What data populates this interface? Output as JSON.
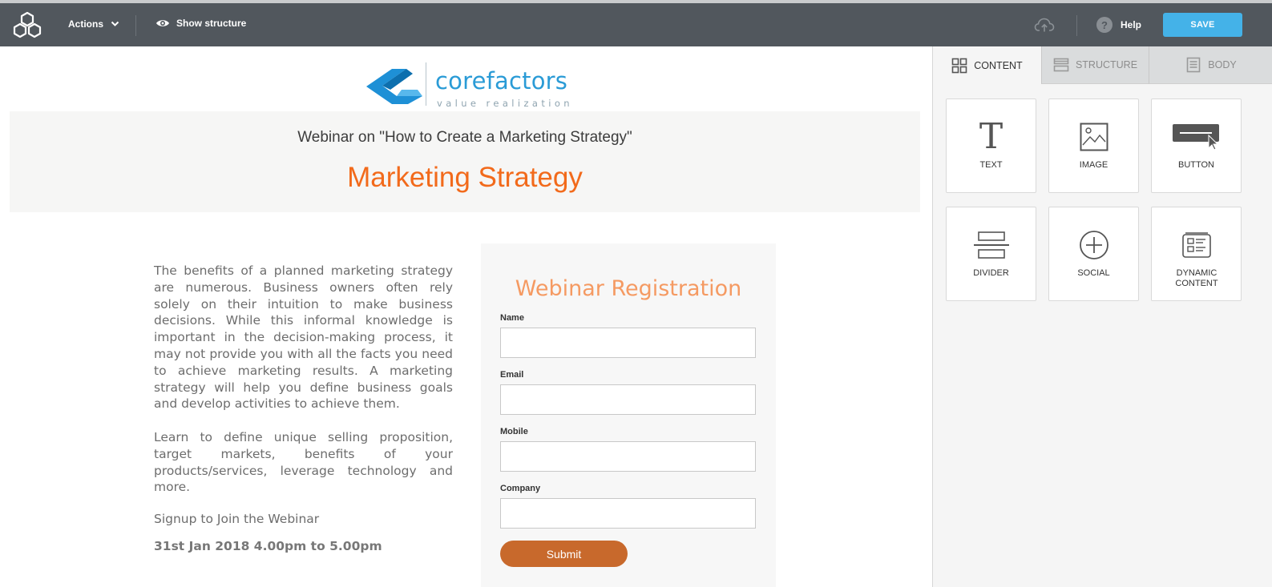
{
  "toolbar": {
    "actions_label": "Actions",
    "show_structure_label": "Show structure",
    "help_label": "Help",
    "save_label": "SAVE"
  },
  "brand": {
    "name": "corefactors",
    "tagline": "value realization"
  },
  "hero": {
    "subtitle": "Webinar on \"How to Create a Marketing Strategy\"",
    "title": "Marketing Strategy"
  },
  "content": {
    "paragraph1": "The benefits of a planned marketing strategy are numerous. Business owners often rely solely on their intuition to make business decisions. While this informal knowledge is important in the decision-making process, it may not provide you with all the facts you need to achieve marketing results. A marketing strategy will help you define business goals and develop activities to achieve them.",
    "paragraph2": "Learn to define unique selling proposition, target markets, benefits of your products/services, leverage technology and more.",
    "signup": "Signup to Join the Webinar",
    "date": "31st Jan 2018 4.00pm to 5.00pm"
  },
  "form": {
    "title": "Webinar Registration",
    "fields": [
      {
        "label": "Name",
        "value": ""
      },
      {
        "label": "Email",
        "value": ""
      },
      {
        "label": "Mobile",
        "value": ""
      },
      {
        "label": "Company",
        "value": ""
      }
    ],
    "submit_label": "Submit"
  },
  "panel": {
    "tabs": [
      {
        "label": "CONTENT",
        "icon": "grid-icon",
        "active": true
      },
      {
        "label": "STRUCTURE",
        "icon": "rows-icon",
        "active": false
      },
      {
        "label": "BODY",
        "icon": "page-icon",
        "active": false
      }
    ],
    "tiles": [
      {
        "label": "TEXT",
        "icon": "text-icon"
      },
      {
        "label": "IMAGE",
        "icon": "image-icon"
      },
      {
        "label": "BUTTON",
        "icon": "button-icon"
      },
      {
        "label": "DIVIDER",
        "icon": "divider-icon"
      },
      {
        "label": "SOCIAL",
        "icon": "social-plus-icon"
      },
      {
        "label": "DYNAMIC CONTENT",
        "icon": "dynamic-content-icon"
      }
    ]
  },
  "colors": {
    "topbar": "#51575d",
    "save_button": "#44b2e8",
    "hero_title": "#f26a1b",
    "form_title": "#f59a62",
    "submit_button": "#c8692c",
    "brand": "#2a9bd6"
  }
}
